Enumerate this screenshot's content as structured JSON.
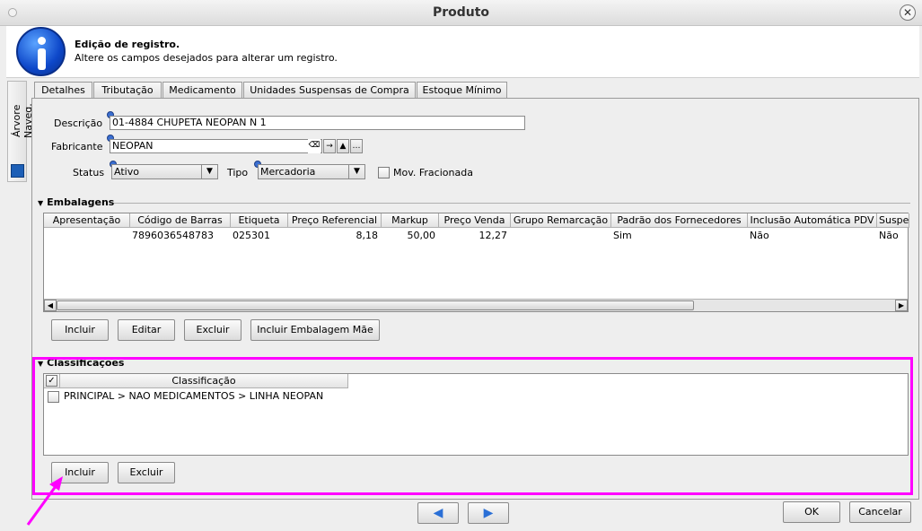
{
  "window": {
    "title": "Produto"
  },
  "info": {
    "title": "Edição de registro.",
    "subtitle": "Altere os campos desejados para alterar um registro."
  },
  "sidebar": {
    "tab_label": "Árvore Naveg."
  },
  "tabs": [
    {
      "label": "Detalhes"
    },
    {
      "label": "Tributação"
    },
    {
      "label": "Medicamento"
    },
    {
      "label": "Unidades Suspensas de Compra"
    },
    {
      "label": "Estoque Mínimo"
    }
  ],
  "form": {
    "descricao_label": "Descrição",
    "descricao_value": "01-4884 CHUPETA NEOPAN N 1",
    "fabricante_label": "Fabricante",
    "fabricante_value": "NEOPAN",
    "status_label": "Status",
    "status_value": "Ativo",
    "tipo_label": "Tipo",
    "tipo_value": "Mercadoria",
    "mov_fracionada_label": "Mov. Fracionada"
  },
  "embalagens": {
    "section_title": "Embalagens",
    "columns": [
      "Apresentação",
      "Código de Barras",
      "Etiqueta",
      "Preço Referencial",
      "Markup",
      "Preço Venda",
      "Grupo Remarcação",
      "Padrão dos Fornecedores",
      "Inclusão Automática PDV",
      "Suspe"
    ],
    "rows": [
      [
        "",
        "7896036548783",
        "025301",
        "8,18",
        "50,00",
        "12,27",
        "",
        "Sim",
        "Não",
        "Não"
      ]
    ],
    "buttons": {
      "incluir": "Incluir",
      "editar": "Editar",
      "excluir": "Excluir",
      "incluir_mae": "Incluir Embalagem Mãe"
    }
  },
  "classificacoes": {
    "section_title": "Classificações",
    "column": "Classificação",
    "rows": [
      "PRINCIPAL > NAO MEDICAMENTOS > LINHA NEOPAN"
    ],
    "buttons": {
      "incluir": "Incluir",
      "excluir": "Excluir"
    }
  },
  "footer": {
    "ok": "OK",
    "cancelar": "Cancelar"
  },
  "colors": {
    "highlight": "#ff00ff",
    "info_icon": "#0d47c9"
  }
}
